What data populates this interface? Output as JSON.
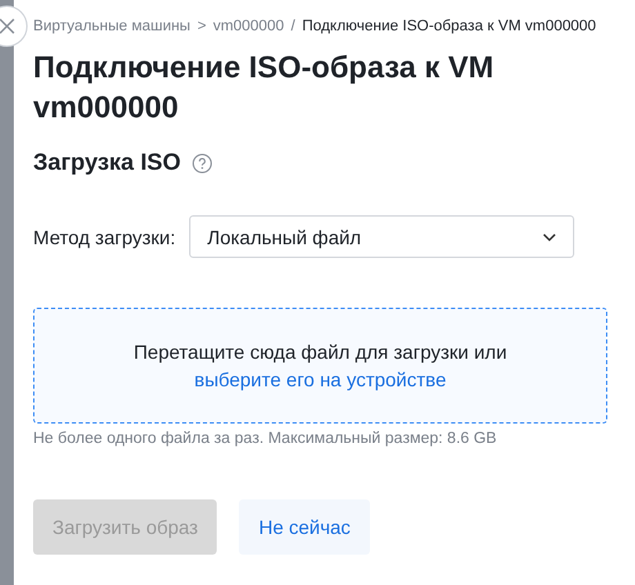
{
  "breadcrumb": [
    {
      "label": "Виртуальные машины",
      "separator": ">",
      "current": false
    },
    {
      "label": "vm000000",
      "separator": "/",
      "current": false
    },
    {
      "label": "Подключение ISO-образа к VM vm000000",
      "current": true
    }
  ],
  "title": "Подключение ISO-образа к VM vm000000",
  "section": {
    "title": "Загрузка ISO"
  },
  "method": {
    "label": "Метод загрузки:",
    "value": "Локальный файл"
  },
  "dropzone": {
    "text": "Перетащите сюда файл для загрузки или",
    "link": "выберите его на устройстве"
  },
  "hint": "Не более одного файла за раз. Максимальный размер: 8.6 GB",
  "buttons": [
    {
      "label": "Загрузить образ",
      "kind": "primary",
      "disabled": true
    },
    {
      "label": "Не сейчас",
      "kind": "secondary",
      "disabled": false
    }
  ]
}
